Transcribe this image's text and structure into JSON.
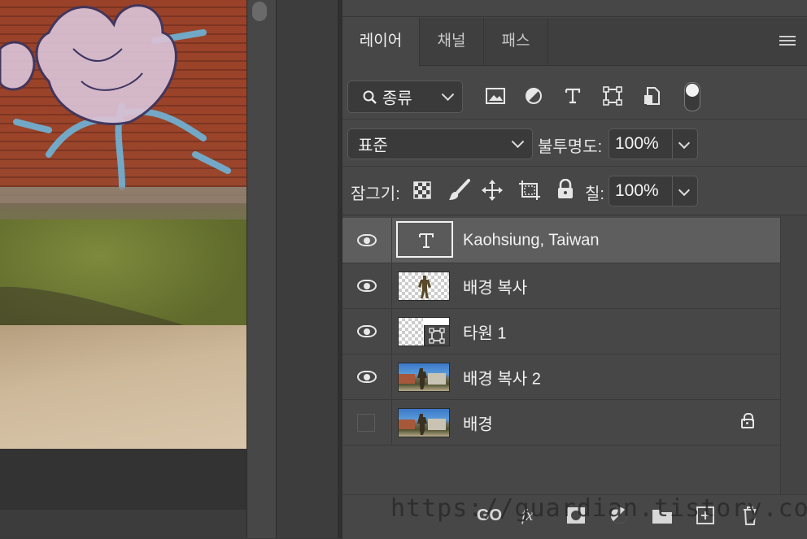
{
  "tabs": [
    {
      "label": "레이어",
      "active": true
    },
    {
      "label": "채널",
      "active": false
    },
    {
      "label": "패스",
      "active": false
    }
  ],
  "filter": {
    "kind_label": "종류",
    "icons": [
      "image-filter-icon",
      "adjustment-filter-icon",
      "type-filter-icon",
      "shape-filter-icon",
      "smart-object-filter-icon",
      "filter-toggle-icon"
    ]
  },
  "blend": {
    "mode": "표준",
    "opacity_label": "불투명도:",
    "opacity_value": "100%"
  },
  "lock": {
    "label": "잠그기:",
    "icons": [
      "lock-transparency-icon",
      "lock-image-icon",
      "lock-position-icon",
      "lock-artboard-icon",
      "lock-all-icon"
    ],
    "fill_label": "칠:",
    "fill_value": "100%"
  },
  "layers": [
    {
      "name": "Kaohsiung, Taiwan",
      "type": "text",
      "visible": true,
      "selected": true
    },
    {
      "name": "배경 복사",
      "type": "image-transparent",
      "visible": true
    },
    {
      "name": "타원 1",
      "type": "shape",
      "visible": true
    },
    {
      "name": "배경 복사 2",
      "type": "image",
      "visible": true
    },
    {
      "name": "배경",
      "type": "image",
      "visible": false,
      "locked": true
    }
  ],
  "footer_icons": [
    "link-layers-icon",
    "fx-icon",
    "layer-mask-icon",
    "adjustment-layer-icon",
    "group-icon",
    "new-layer-icon",
    "delete-layer-icon"
  ],
  "footer_labels": {
    "link": "GO",
    "fx": "fx"
  },
  "watermark": "https://guardian.tistory.com/",
  "colors": {
    "panel": "#474747",
    "selected_row": "#5e5e5e",
    "tab_bar": "#3f3f3f"
  }
}
